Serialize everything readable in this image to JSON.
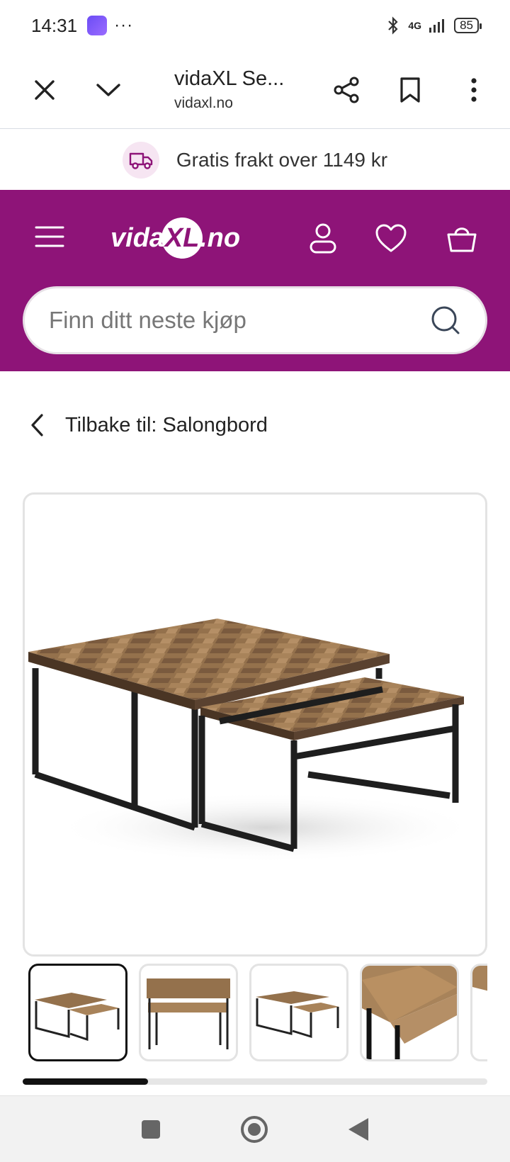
{
  "status": {
    "time": "14:31",
    "dots": "···",
    "network": "4G",
    "battery": "85"
  },
  "browser": {
    "title": "vidaXL Se...",
    "url": "vidaxl.no"
  },
  "promo": {
    "text": "Gratis frakt over 1149 kr"
  },
  "header": {
    "logo_left": "vida",
    "logo_mid": "XL",
    "logo_right": ".no",
    "background_color": "#8e1478"
  },
  "search": {
    "placeholder": "Finn ditt neste kjøp"
  },
  "breadcrumb": {
    "back_label": "Tilbake til: Salongbord"
  },
  "gallery": {
    "thumbnails": [
      "main-view",
      "front-view",
      "side-view",
      "close-up",
      "partial"
    ],
    "active_index": 0,
    "scroll_fraction": 0.27
  },
  "icons": {
    "close": "close-icon",
    "expand": "chevron-down-icon",
    "share": "share-icon",
    "bookmark": "bookmark-icon",
    "more": "more-vertical-icon",
    "menu": "hamburger-icon",
    "account": "user-icon",
    "wishlist": "heart-icon",
    "cart": "basket-icon",
    "search": "search-icon",
    "back": "chevron-left-icon",
    "truck": "truck-icon"
  }
}
